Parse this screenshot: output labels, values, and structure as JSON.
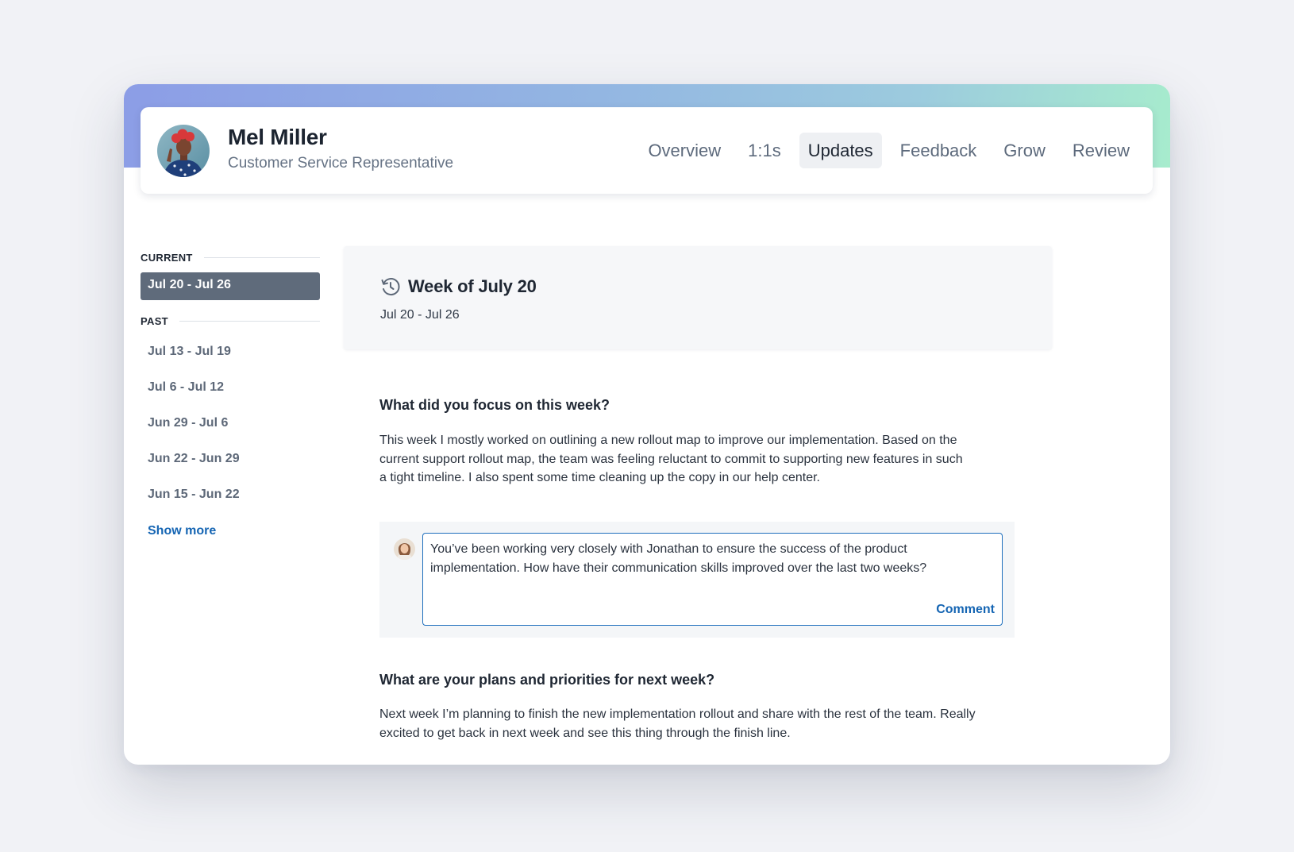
{
  "profile": {
    "name": "Mel Miller",
    "role": "Customer Service Representative"
  },
  "nav": {
    "tabs": [
      {
        "label": "Overview",
        "active": false
      },
      {
        "label": "1:1s",
        "active": false
      },
      {
        "label": "Updates",
        "active": true
      },
      {
        "label": "Feedback",
        "active": false
      },
      {
        "label": "Grow",
        "active": false
      },
      {
        "label": "Review",
        "active": false
      }
    ]
  },
  "sidebar": {
    "current_label": "CURRENT",
    "current_week": "Jul 20 - Jul 26",
    "past_label": "PAST",
    "past_weeks": [
      "Jul 13 - Jul 19",
      "Jul 6 - Jul 12",
      "Jun 29 - Jul 6",
      "Jun 22 - Jun 29",
      "Jun 15 - Jun 22"
    ],
    "show_more": "Show more"
  },
  "week": {
    "icon": "history-icon",
    "title": "Week of July 20",
    "range": "Jul 20 - Jul 26"
  },
  "questions": [
    {
      "question": "What did you focus on this week?",
      "answer": "This week I mostly worked on outlining a new rollout map to improve our implementation. Based on the current support rollout map, the team was feeling reluctant to commit to supporting new features in such a tight timeline. I also spent some time cleaning up the copy in our help center."
    },
    {
      "question": "What are your plans and priorities for next week?",
      "answer": "Next week I’m planning to finish the new implementation rollout and share with the rest of the team. Really excited to get back in next week and see this thing through the finish line."
    }
  ],
  "comment": {
    "text": "You’ve been working very closely with Jonathan to ensure the success of the product implementation. How have their communication skills improved over the last two weeks?",
    "button_label": "Comment"
  },
  "colors": {
    "accent": "#1565b3",
    "selected_week_bg": "#5f6b7b",
    "banner_start": "#8c9de6",
    "banner_end": "#a7eccd"
  }
}
